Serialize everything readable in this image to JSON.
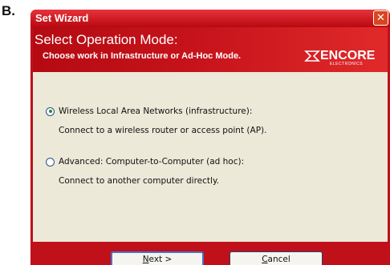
{
  "figure_label": "B.",
  "window": {
    "title": "Set Wizard",
    "close_glyph": "✕"
  },
  "header": {
    "heading": "Select Operation Mode:",
    "subheading": "Choose work in Infrastructure or Ad-Hoc Mode.",
    "logo": {
      "name": "ENCORE",
      "tagline": "ELECTRONICS"
    }
  },
  "options": [
    {
      "label": "Wireless Local Area Networks (infrastructure):",
      "description": "Connect to a wireless router or access point (AP).",
      "selected": true
    },
    {
      "label": "Advanced: Computer-to-Computer (ad hoc):",
      "description": "Connect to another computer directly.",
      "selected": false
    }
  ],
  "buttons": {
    "next": {
      "mnemonic": "N",
      "rest": "ext >"
    },
    "cancel": {
      "mnemonic": "C",
      "rest": "ancel"
    }
  },
  "colors": {
    "brand_red": "#c0101a",
    "dialog_bg": "#ece9d8"
  },
  "icons": {
    "close": "close-icon",
    "radio_on": "radio-checked-icon",
    "radio_off": "radio-unchecked-icon"
  }
}
